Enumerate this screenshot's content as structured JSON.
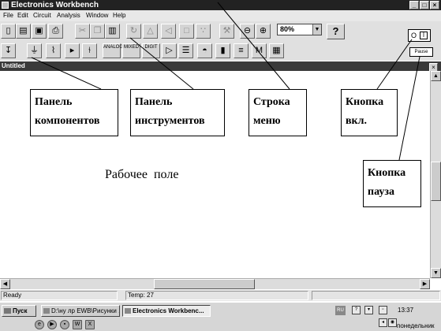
{
  "window": {
    "title": "Electronics Workbench",
    "controls": [
      "_",
      "□",
      "×"
    ]
  },
  "menu": [
    "File",
    "Edit",
    "Circuit",
    "Analysis",
    "Window",
    "Help"
  ],
  "toolbar_top": {
    "buttons": [
      {
        "name": "new-file-icon",
        "glyph": "▯"
      },
      {
        "name": "open-folder-icon",
        "glyph": "▤"
      },
      {
        "name": "save-icon",
        "glyph": "▣"
      },
      {
        "name": "print-icon",
        "glyph": "⎙"
      },
      {
        "name": "cut-icon",
        "glyph": "✂"
      },
      {
        "name": "copy-icon",
        "glyph": "❐"
      },
      {
        "name": "paste-icon",
        "glyph": "▥"
      },
      {
        "name": "rotate-icon",
        "glyph": "↻"
      },
      {
        "name": "flip-vertical-icon",
        "glyph": "△"
      },
      {
        "name": "flip-horizontal-icon",
        "glyph": "◁"
      },
      {
        "name": "subcircuit-icon",
        "glyph": "□"
      },
      {
        "name": "graph-icon",
        "glyph": "∵"
      },
      {
        "name": "component-properties-icon",
        "glyph": "⚒"
      },
      {
        "name": "zoom-out-icon",
        "glyph": "⊖"
      },
      {
        "name": "zoom-in-icon",
        "glyph": "⊕"
      }
    ],
    "zoom_value": "80%",
    "help_label": "?"
  },
  "toolbar_parts": {
    "buttons": [
      {
        "name": "favorites-bin-icon",
        "glyph": "↧",
        "label": ""
      },
      {
        "name": "sources-bin-icon",
        "glyph": "⏚",
        "label": ""
      },
      {
        "name": "basic-bin-icon",
        "glyph": "⌇",
        "label": ""
      },
      {
        "name": "diodes-bin-icon",
        "glyph": "▸",
        "label": ""
      },
      {
        "name": "transistors-bin-icon",
        "glyph": "⫮",
        "label": ""
      },
      {
        "name": "analog-ics-bin-icon",
        "glyph": "",
        "label": "ANALOG"
      },
      {
        "name": "mixed-ics-bin-icon",
        "glyph": "",
        "label": "MIXED"
      },
      {
        "name": "digital-ics-bin-icon",
        "glyph": "",
        "label": "DIGIT"
      },
      {
        "name": "logic-gates-bin-icon",
        "glyph": "▷",
        "label": ""
      },
      {
        "name": "digital-bin-icon",
        "glyph": "☰",
        "label": ""
      },
      {
        "name": "indicators-bin-icon",
        "glyph": "◓",
        "label": ""
      },
      {
        "name": "controls-bin-icon",
        "glyph": "▮",
        "label": ""
      },
      {
        "name": "miscellaneous-bin-icon",
        "glyph": "≡",
        "label": ""
      },
      {
        "name": "instruments-bin-icon",
        "glyph": "M",
        "label": ""
      },
      {
        "name": "meters-bin-icon",
        "glyph": "▦",
        "label": ""
      }
    ]
  },
  "power_switch": {
    "off": "O",
    "on": "I"
  },
  "pause_label": "Pause",
  "document": {
    "title": "Untitled",
    "close": "×"
  },
  "annotations": {
    "components_panel": "Панель\nкомпонентов",
    "instruments_panel": "Панель\nинструментов",
    "menu_bar": "Строка\nменю",
    "power_button": "Кнопка\nвкл.",
    "pause_button": "Кнопка\nпауза",
    "work_field": "Рабочее  поле"
  },
  "status": {
    "left": "Ready",
    "temp": "Temp:  27"
  },
  "taskbar": {
    "start": "Пуск",
    "tasks": [
      "D:\\ну лр EWB\\Рисунки ...",
      "Electronics Workbenc..."
    ],
    "lang": "RU",
    "time": "13:37",
    "day": "понедельник"
  },
  "colors": {
    "title_bar": "#222222",
    "doc_title_bar": "#3a3a3a",
    "chrome": "#d4d4d4"
  }
}
